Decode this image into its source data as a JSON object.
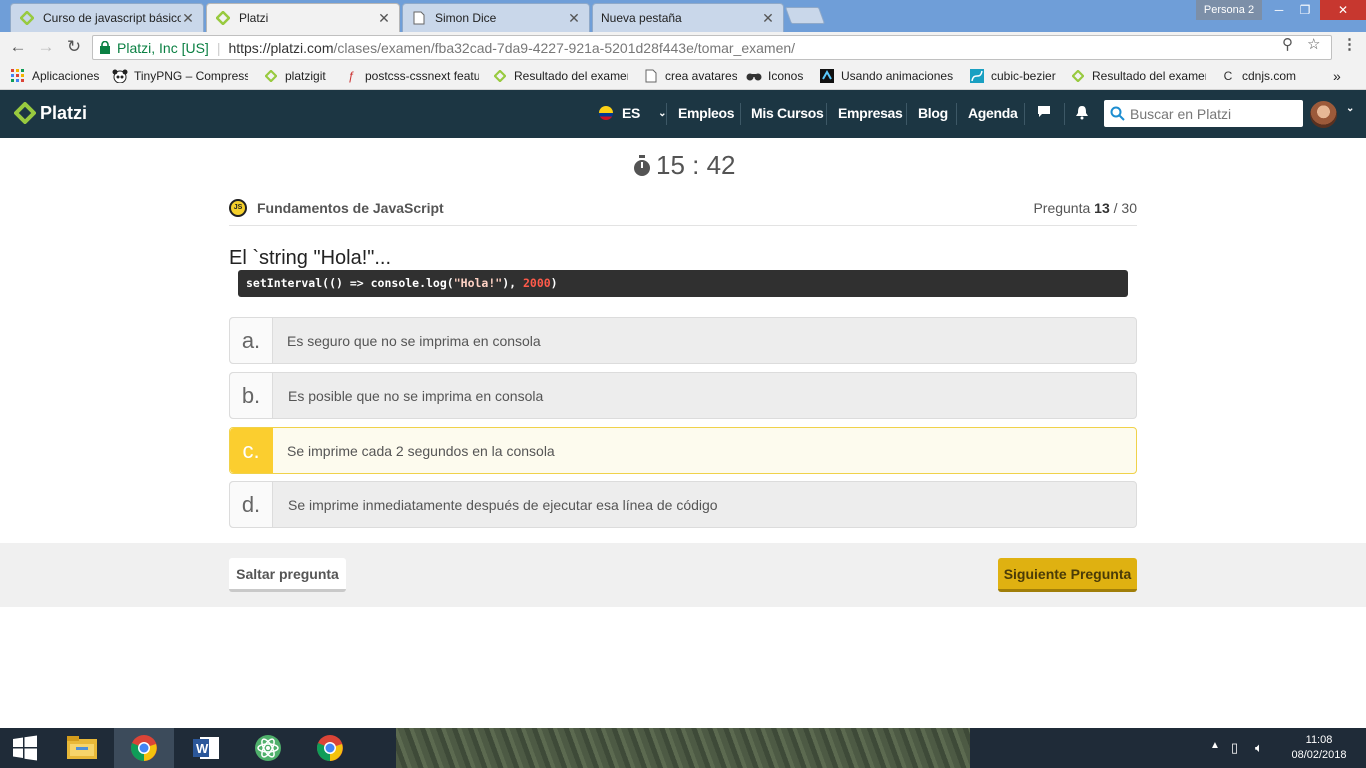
{
  "browser": {
    "tabs": [
      {
        "label": "Curso de javascript básico",
        "favicon": "platzi-icon",
        "active": false
      },
      {
        "label": "Platzi",
        "favicon": "platzi-icon",
        "active": true
      },
      {
        "label": "Simon Dice",
        "favicon": "page-icon",
        "active": false
      },
      {
        "label": "Nueva pestaña",
        "favicon": "none",
        "active": false
      }
    ],
    "profile": "Persona 2",
    "address": {
      "secure_label": "Platzi, Inc [US]",
      "url_host": "https://platzi.com",
      "url_path": "/clases/examen/fba32cad-7da9-4227-921a-5201d28f443e/tomar_examen/"
    },
    "bookmarks": [
      {
        "label": "Aplicaciones",
        "icon": "apps-grid-icon"
      },
      {
        "label": "TinyPNG – Compress",
        "icon": "panda-icon"
      },
      {
        "label": "platzigit",
        "icon": "platzi-icon"
      },
      {
        "label": "postcss-cssnext featu",
        "icon": "postcss-icon"
      },
      {
        "label": "Resultado del examen",
        "icon": "platzi-icon"
      },
      {
        "label": "crea avatares",
        "icon": "page-icon"
      },
      {
        "label": "Iconos",
        "icon": "binoculars-icon"
      },
      {
        "label": "Usando animaciones",
        "icon": "mdn-icon"
      },
      {
        "label": "cubic-bezier",
        "icon": "curve-icon"
      },
      {
        "label": "Resultado del examen",
        "icon": "platzi-icon"
      },
      {
        "label": "cdnjs.com",
        "icon": "cdnjs-icon"
      }
    ],
    "more_bookmarks": "»"
  },
  "header": {
    "logo_text": "Platzi",
    "lang": "ES",
    "nav": [
      "Empleos",
      "Mis Cursos",
      "Empresas",
      "Blog",
      "Agenda"
    ],
    "search_placeholder": "Buscar en Platzi"
  },
  "exam": {
    "timer": "15 : 42",
    "course_badge": "JS",
    "course_name": "Fundamentos de JavaScript",
    "question_label": "Pregunta",
    "question_current": "13",
    "question_total": "/ 30",
    "question_text": "El `string \"Hola!\"...",
    "code": {
      "prefix": "setInterval(() => console.log(",
      "string": "\"Hola!\"",
      "middle": "), ",
      "number": "2000",
      "suffix": ")"
    },
    "answers": [
      {
        "letter": "a.",
        "text": "Es seguro que no se imprima en consola",
        "selected": false
      },
      {
        "letter": "b.",
        "text": "Es posible que no se imprima en consola",
        "selected": false
      },
      {
        "letter": "c.",
        "text": "Se imprime cada 2 segundos en la consola",
        "selected": true
      },
      {
        "letter": "d.",
        "text": "Se imprime inmediatamente después de ejecutar esa línea de código",
        "selected": false
      }
    ],
    "skip_label": "Saltar pregunta",
    "next_label": "Siguiente Pregunta"
  },
  "taskbar": {
    "apps": [
      "windows-start-icon",
      "file-explorer-icon",
      "chrome-icon",
      "word-icon",
      "atom-icon",
      "chrome-icon"
    ],
    "time": "11:08",
    "date": "08/02/2018"
  },
  "colors": {
    "platzi_header": "#1c3643",
    "platzi_green": "#98ca3f",
    "selected_answer": "#fbce2f",
    "next_button": "#dfb111"
  }
}
